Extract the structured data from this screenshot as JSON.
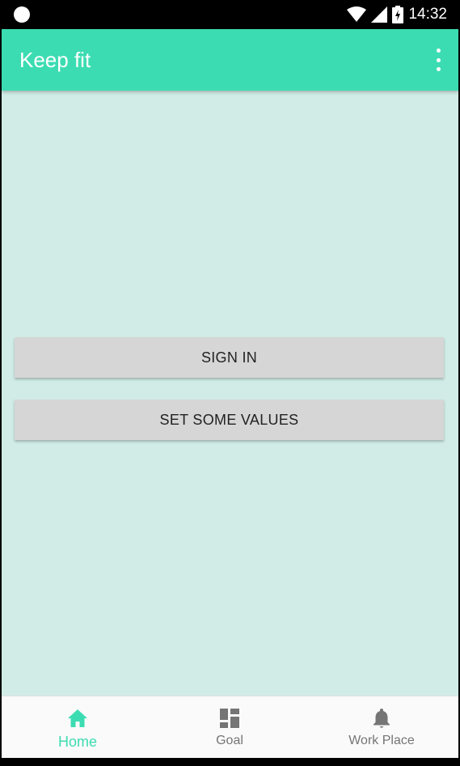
{
  "status_bar": {
    "time": "14:32"
  },
  "app_bar": {
    "title": "Keep fit",
    "menu_icon": "more-vert-icon"
  },
  "buttons": {
    "sign_in": "SIGN IN",
    "set_values": "SET SOME VALUES"
  },
  "bottom_nav": {
    "items": [
      {
        "label": "Home",
        "icon": "home-icon",
        "active": true
      },
      {
        "label": "Goal",
        "icon": "dashboard-icon",
        "active": false
      },
      {
        "label": "Work Place",
        "icon": "bell-icon",
        "active": false
      }
    ]
  },
  "colors": {
    "accent": "#3cdcb2",
    "background": "#d1ece6",
    "button": "#d6d6d6",
    "inactive_icon": "#757575"
  }
}
